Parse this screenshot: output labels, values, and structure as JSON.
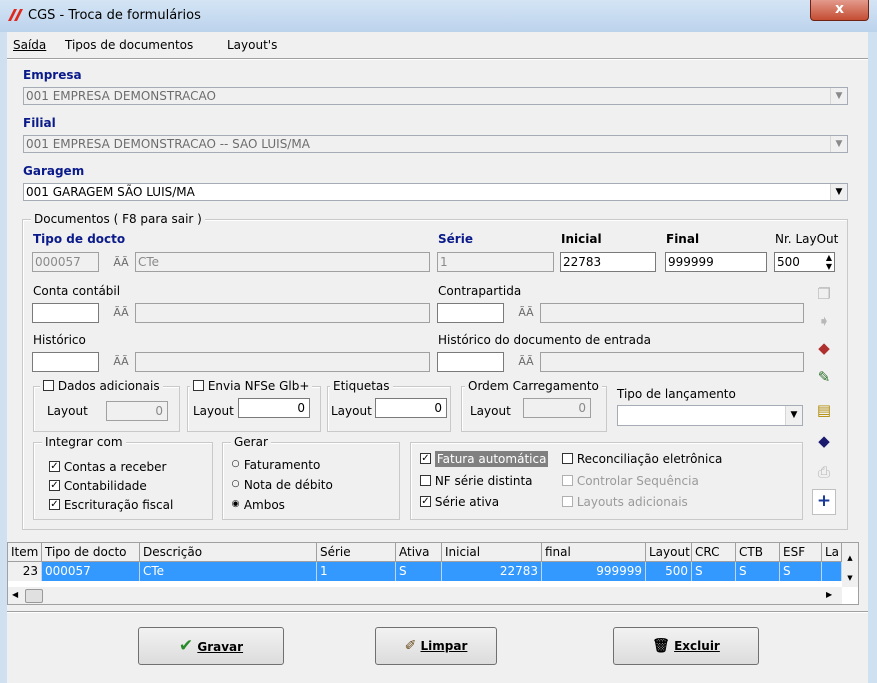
{
  "window": {
    "title": "CGS - Troca de formulários",
    "close_label": "x"
  },
  "menu": [
    "Saída",
    "Tipos de documentos",
    "Layout's"
  ],
  "empresa": {
    "label": "Empresa",
    "value": "001 EMPRESA DEMONSTRACAO"
  },
  "filial": {
    "label": "Filial",
    "value": "001 EMPRESA DEMONSTRACAO -- SAO LUIS/MA"
  },
  "garagem": {
    "label": "Garagem",
    "value": "001 GARAGEM SÃO LUIS/MA"
  },
  "documentos": {
    "group_title": "Documentos ( F8 para sair )",
    "tipo_label": "Tipo de docto",
    "tipo_code": "000057",
    "tipo_desc": "CTe",
    "serie_label": "Série",
    "serie_value": "1",
    "inicial_label": "Inicial",
    "inicial_value": "22783",
    "final_label": "Final",
    "final_value": "999999",
    "nr_layout_label": "Nr. LayOut",
    "nr_layout_value": "500",
    "conta_label": "Conta contábil",
    "contrapartida_label": "Contrapartida",
    "historico_label": "Histórico",
    "historico_entrada_label": "Histórico do documento de entrada"
  },
  "dados_adicionais": {
    "title": "Dados adicionais",
    "layout_label": "Layout",
    "layout_value": "0",
    "checked": false
  },
  "envia_nfse": {
    "title": "Envia NFSe Glb+",
    "layout_label": "Layout",
    "layout_value": "0",
    "checked": false
  },
  "etiquetas": {
    "title": "Etiquetas",
    "layout_label": "Layout",
    "layout_value": "0"
  },
  "ordem": {
    "title": "Ordem Carregamento",
    "layout_label": "Layout",
    "layout_value": "0"
  },
  "tipo_lancamento": {
    "label": "Tipo de lançamento",
    "value": ""
  },
  "integrar": {
    "title": "Integrar com",
    "items": [
      {
        "label": "Contas a receber",
        "checked": true
      },
      {
        "label": "Contabilidade",
        "checked": true
      },
      {
        "label": "Escrituração fiscal",
        "checked": true
      }
    ]
  },
  "gerar": {
    "title": "Gerar",
    "options": [
      "Faturamento",
      "Nota de débito",
      "Ambos"
    ],
    "selected": "Ambos"
  },
  "flags": {
    "fatura": {
      "label": "Fatura automática",
      "checked": true
    },
    "nf_serie": {
      "label": "NF série distinta",
      "checked": false
    },
    "serie_ativa": {
      "label": "Série ativa",
      "checked": true
    },
    "reconciliacao": {
      "label": "Reconciliação eletrônica",
      "checked": false
    },
    "controlar": {
      "label": "Controlar Sequência",
      "checked": false,
      "disabled": true
    },
    "layouts_adic": {
      "label": "Layouts adicionais",
      "checked": false,
      "disabled": true
    }
  },
  "grid": {
    "columns": [
      "Item",
      "Tipo de docto",
      "Descrição",
      "Série",
      "Ativa",
      "Inicial",
      "final",
      "Layout",
      "CRC",
      "CTB",
      "ESF",
      "La"
    ],
    "rows": [
      [
        "23",
        "000057",
        "CTe",
        "1",
        "S",
        "22783",
        "999999",
        "500",
        "S",
        "S",
        "S",
        ""
      ]
    ]
  },
  "buttons": {
    "gravar": "Gravar",
    "limpar": "Limpar",
    "excluir": "Excluir"
  },
  "colors": {
    "label_blue": "#0a1a8a",
    "selection": "#3399ff",
    "titlebar": "#bcd3ec",
    "close": "#c44d33"
  }
}
